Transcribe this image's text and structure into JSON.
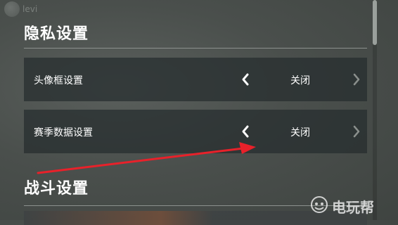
{
  "top_faded": {
    "name": "levi"
  },
  "privacy_section": {
    "title": "隐私设置",
    "items": [
      {
        "label": "头像框设置",
        "value": "关闭"
      },
      {
        "label": "赛季数据设置",
        "value": "关闭"
      }
    ]
  },
  "battle_section": {
    "title": "战斗设置"
  },
  "watermark": {
    "text": "电玩帮"
  },
  "colors": {
    "annotation_arrow": "#e8212a"
  },
  "icons": {
    "left": "chevron-left-icon",
    "right": "chevron-right-icon"
  }
}
